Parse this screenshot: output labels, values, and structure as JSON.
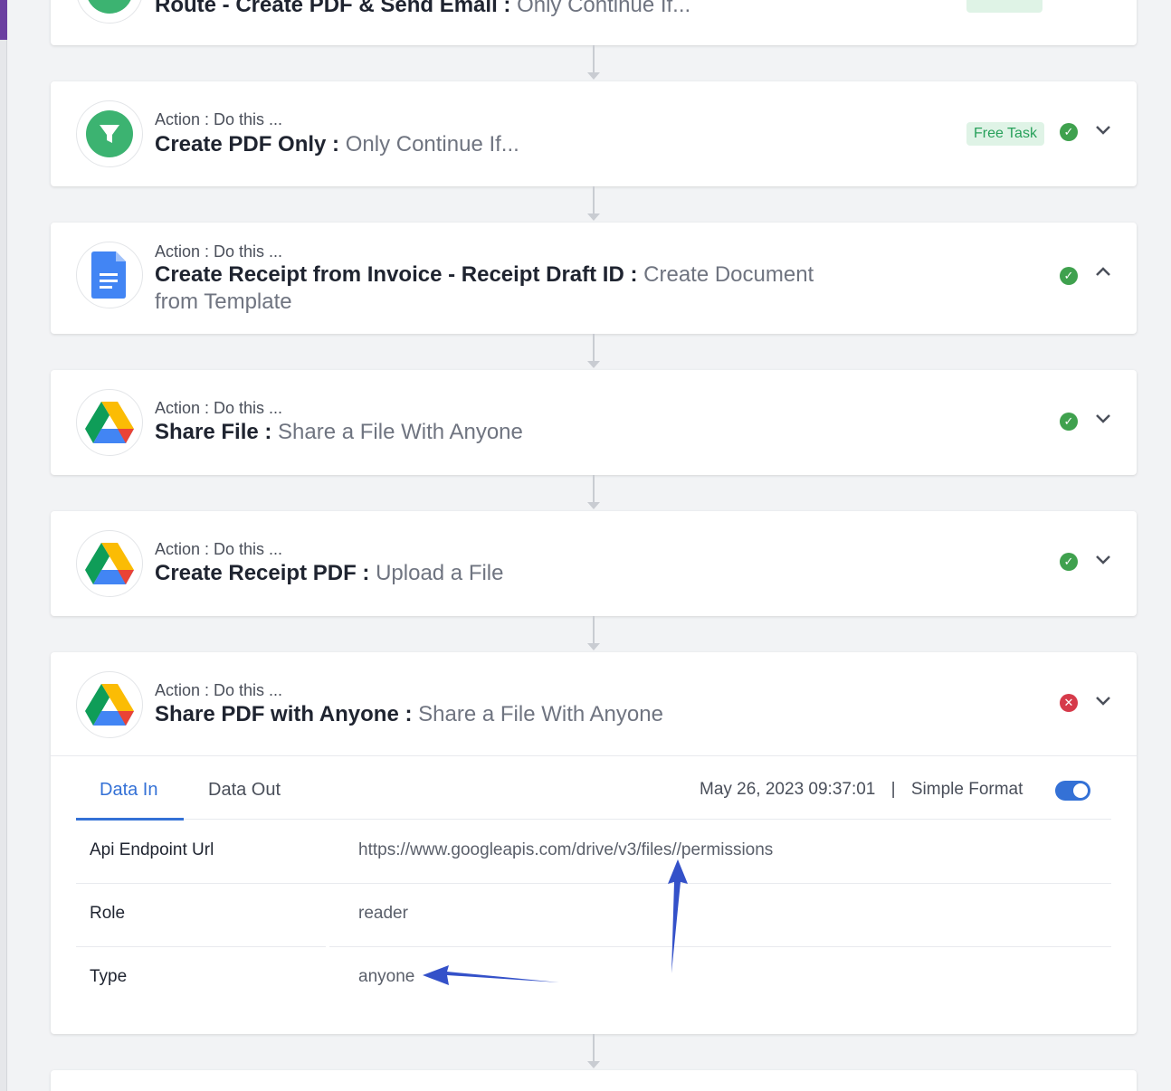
{
  "steps": [
    {
      "label": "",
      "app": "Route - Create PDF & Send Email",
      "sep": " : ",
      "event": "Only Continue If...",
      "badge": ""
    },
    {
      "label": "Action : Do this ...",
      "app": "Create PDF Only",
      "sep": " : ",
      "event": "Only Continue If...",
      "badge": "Free Task"
    },
    {
      "label": "Action : Do this ...",
      "app": "Create Receipt from Invoice - Receipt Draft ID",
      "sep": " : ",
      "event": "Create Document",
      "event2": "from Template"
    },
    {
      "label": "Action : Do this ...",
      "app": "Share File",
      "sep": " : ",
      "event": "Share a File With Anyone"
    },
    {
      "label": "Action : Do this ...",
      "app": "Create Receipt PDF",
      "sep": " : ",
      "event": "Upload a File"
    },
    {
      "label": "Action : Do this ...",
      "app": "Share PDF with Anyone",
      "sep": " : ",
      "event": "Share a File With Anyone"
    }
  ],
  "icons": {
    "filter": "filter-icon",
    "docs": "google-docs-icon",
    "drive": "google-drive-icon",
    "success": "check-circle-icon",
    "error": "x-circle-icon"
  },
  "detail": {
    "tabs": {
      "data_in": "Data In",
      "data_out": "Data Out"
    },
    "timestamp": "May 26, 2023 09:37:01",
    "divider": "|",
    "format_label": "Simple Format",
    "format_on": true,
    "rows": [
      {
        "key": "Api Endpoint Url",
        "value": "https://www.googleapis.com/drive/v3/files//permissions"
      },
      {
        "key": "Role",
        "value": "reader"
      },
      {
        "key": "Type",
        "value": "anyone"
      }
    ]
  },
  "colors": {
    "accent": "#3471d6",
    "success": "#3fa14e",
    "error": "#d63a4a",
    "annotation": "#3451c9"
  }
}
